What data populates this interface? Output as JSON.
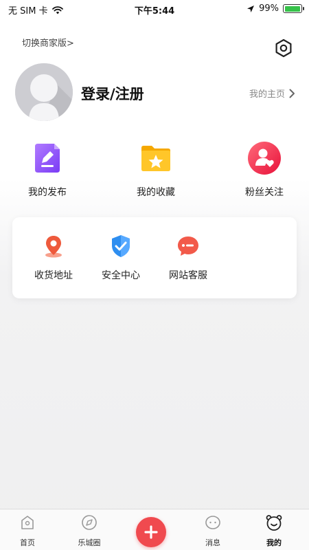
{
  "status_bar": {
    "carrier": "无 SIM 卡",
    "time": "下午5:44",
    "battery": "99%",
    "battery_level": 0.99
  },
  "header": {
    "switch_link": "切换商家版>"
  },
  "profile": {
    "login_label": "登录/注册",
    "homepage_label": "我的主页"
  },
  "quick_actions": [
    {
      "label": "我的发布",
      "icon": "edit-document-icon",
      "color": "#8a4dff"
    },
    {
      "label": "我的收藏",
      "icon": "star-folder-icon",
      "color": "#ffbf1f"
    },
    {
      "label": "粉丝关注",
      "icon": "fans-heart-icon",
      "color": "#f0344d"
    }
  ],
  "services": [
    {
      "label": "收货地址",
      "icon": "location-pin-icon",
      "color": "#ee5a3c"
    },
    {
      "label": "安全中心",
      "icon": "shield-check-icon",
      "color": "#2e8ef0"
    },
    {
      "label": "网站客服",
      "icon": "chat-bubble-icon",
      "color": "#f25a4a"
    }
  ],
  "tabbar": {
    "tabs": [
      {
        "label": "首页",
        "icon": "home-icon"
      },
      {
        "label": "乐城圈",
        "icon": "compass-icon"
      },
      {
        "label": "消息",
        "icon": "message-icon"
      },
      {
        "label": "我的",
        "icon": "profile-face-icon",
        "active": true
      }
    ],
    "fab_icon": "plus-icon"
  }
}
